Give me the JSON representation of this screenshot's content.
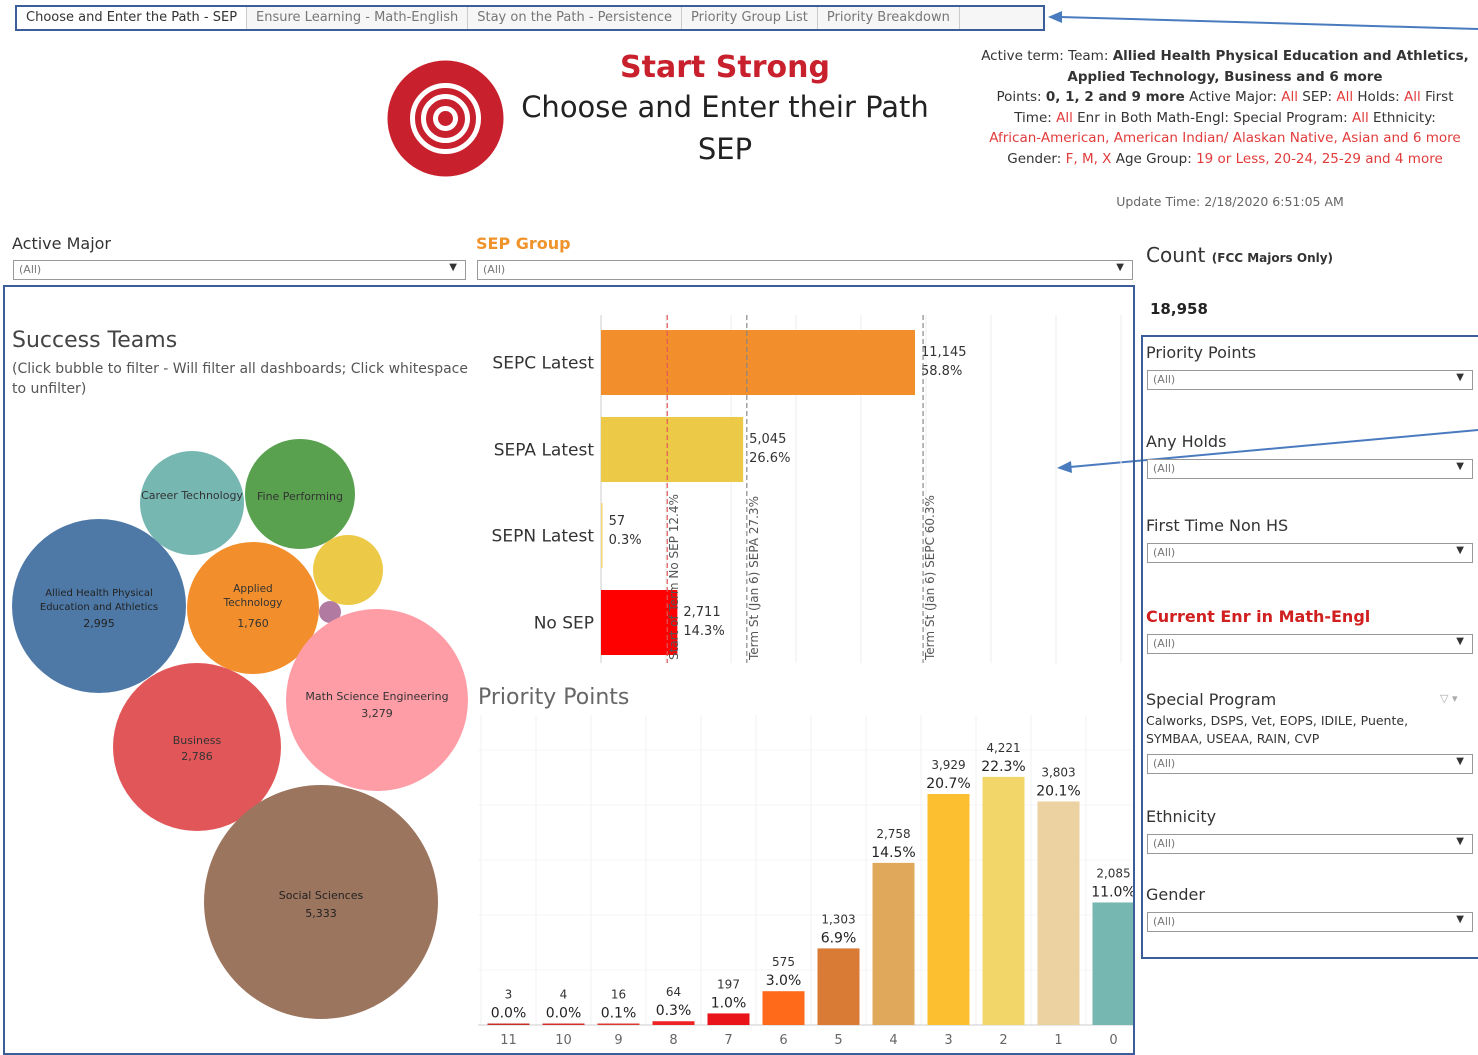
{
  "tabs": [
    {
      "label": "Choose and Enter the Path - SEP",
      "active": true
    },
    {
      "label": "Ensure Learning - Math-English",
      "active": false
    },
    {
      "label": "Stay on the Path - Persistence",
      "active": false
    },
    {
      "label": "Priority Group List",
      "active": false
    },
    {
      "label": "Priority Breakdown",
      "active": false
    }
  ],
  "header": {
    "title": "Start Strong",
    "subtitle1": "Choose and Enter their Path",
    "subtitle2": "SEP",
    "logo_icon": "target-icon",
    "brand_color": "#c8202c"
  },
  "info": {
    "line1_key": "Active term:",
    "line1_team_key": "Team:",
    "line1_team_val": "Allied Health Physical Education and Athletics,",
    "line2": "Applied Technology, Business and 6 more",
    "points_key": "Points:",
    "points_val": "0, 1, 2 and 9 more",
    "active_major_key": "Active Major:",
    "all": "All",
    "sep_key": "SEP:",
    "holds_key": "Holds:",
    "first_key": "First",
    "time_key": "Time:",
    "enr_key": "Enr in Both Math-Engl:",
    "special_key": "Special Program:",
    "ethnicity_key": "Ethnicity:",
    "ethnicity_val": "African-American, American Indian/ Alaskan Native, Asian and 6 more",
    "gender_key": "Gender:",
    "gender_val": "F, M, X",
    "age_key": "Age Group:",
    "age_val": "19 or Less, 20-24, 25-29 and 4 more"
  },
  "update_time": "Update Time: 2/18/2020 6:51:05 AM",
  "filters": {
    "active_major": {
      "label": "Active Major",
      "value": "(All)"
    },
    "sep_group": {
      "label": "SEP Group",
      "value": "(All)",
      "color": "#f0932b"
    }
  },
  "count": {
    "title": "Count",
    "qualifier": "(FCC Majors Only)",
    "value": "18,958"
  },
  "right_filters": [
    {
      "label": "Priority Points",
      "value": "(All)"
    },
    {
      "label": "Any Holds",
      "value": "(All)"
    },
    {
      "label": "First Time Non HS",
      "value": "(All)"
    },
    {
      "label": "Current Enr in Math-Engl",
      "value": "(All)",
      "highlight": true
    },
    {
      "label": "Special Program",
      "value": "(All)",
      "sub": "Calworks, DSPS, Vet, EOPS, IDILE, Puente, SYMBAA, USEAA, RAIN, CVP"
    },
    {
      "label": "Ethnicity",
      "value": "(All)"
    },
    {
      "label": "Gender",
      "value": "(All)"
    }
  ],
  "success_teams": {
    "title": "Success Teams",
    "subtitle": "(Click bubble to filter - Will filter all dashboards; Click whitespace to unfilter)",
    "bubbles": [
      {
        "name": "Career Technology",
        "value": "",
        "color": "#76b7b2"
      },
      {
        "name": "Fine Performing",
        "value": "",
        "color": "#59a14f"
      },
      {
        "name": "Allied Health Physical Education and Athletics",
        "value": "2,995",
        "color": "#4e79a7"
      },
      {
        "name": "Applied Technology",
        "value": "1,760",
        "color": "#f28e2b"
      },
      {
        "name": "",
        "value": "",
        "color": "#edc948"
      },
      {
        "name": "",
        "value": "",
        "color": "#b07aa1"
      },
      {
        "name": "Math Science Engineering",
        "value": "3,279",
        "color": "#ff9da7"
      },
      {
        "name": "Business",
        "value": "2,786",
        "color": "#e15759"
      },
      {
        "name": "Social Sciences",
        "value": "5,333",
        "color": "#9c755f"
      }
    ]
  },
  "chart_data": [
    {
      "type": "bar",
      "orientation": "horizontal",
      "categories": [
        "SEPC Latest",
        "SEPA Latest",
        "SEPN Latest",
        "No SEP"
      ],
      "values": [
        11145,
        5045,
        57,
        2711
      ],
      "value_labels": [
        "11,145",
        "5,045",
        "57",
        "2,711"
      ],
      "percent_labels": [
        "58.8%",
        "26.6%",
        "0.3%",
        "14.3%"
      ],
      "colors": [
        "#f28e2b",
        "#edc948",
        "#f4d77a",
        "#ff0000"
      ],
      "reference_lines": [
        {
          "label": "Start of Term No SEP 12.4%",
          "value": 2351,
          "color": "#e15759"
        },
        {
          "label": "Term St (Jan 6) SEPA 27.3%",
          "value": 5176,
          "color": "#888888"
        },
        {
          "label": "Term St (Jan 6) SEPC 60.3%",
          "value": 11432,
          "color": "#888888"
        }
      ],
      "xlim": [
        0,
        22000
      ]
    },
    {
      "type": "bar",
      "title": "Priority Points",
      "categories": [
        "11",
        "10",
        "9",
        "8",
        "7",
        "6",
        "5",
        "4",
        "3",
        "2",
        "1",
        "0"
      ],
      "values": [
        3,
        4,
        16,
        64,
        197,
        575,
        1303,
        2758,
        3929,
        4221,
        3803,
        2085
      ],
      "value_labels": [
        "3",
        "4",
        "16",
        "64",
        "197",
        "575",
        "1,303",
        "2,758",
        "3,929",
        "4,221",
        "3,803",
        "2,085"
      ],
      "percent_labels": [
        "0.0%",
        "0.0%",
        "0.1%",
        "0.3%",
        "1.0%",
        "3.0%",
        "6.9%",
        "14.5%",
        "20.7%",
        "22.3%",
        "20.1%",
        "11.0%"
      ],
      "colors": [
        "#c9302c",
        "#d62f2f",
        "#dd3a2f",
        "#ee2424",
        "#e8141a",
        "#ff6a1a",
        "#d97a35",
        "#e0a85a",
        "#fcbf2f",
        "#f2d66a",
        "#ecd2a0",
        "#76b7b2"
      ],
      "ylim": [
        0,
        4800
      ]
    }
  ]
}
